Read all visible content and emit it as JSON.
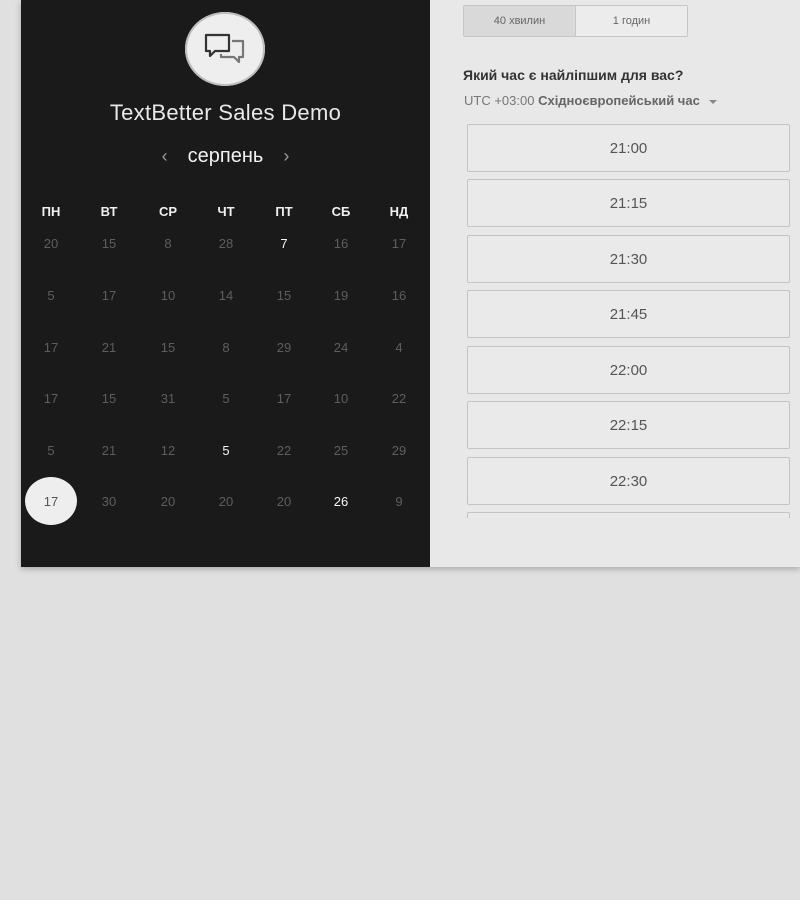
{
  "calendar": {
    "title": "TextBetter Sales Demo",
    "month": "серпень",
    "weekdays": [
      "ПН",
      "ВТ",
      "СР",
      "ЧТ",
      "ПТ",
      "СБ",
      "НД"
    ],
    "weeks": [
      [
        {
          "d": "20"
        },
        {
          "d": "15"
        },
        {
          "d": "8"
        },
        {
          "d": "28"
        },
        {
          "d": "7",
          "available": true
        },
        {
          "d": "16"
        },
        {
          "d": "17"
        }
      ],
      [
        {
          "d": "5"
        },
        {
          "d": "17"
        },
        {
          "d": "10"
        },
        {
          "d": "14"
        },
        {
          "d": "15"
        },
        {
          "d": "19"
        },
        {
          "d": "16"
        }
      ],
      [
        {
          "d": "17"
        },
        {
          "d": "21"
        },
        {
          "d": "15"
        },
        {
          "d": "8"
        },
        {
          "d": "29"
        },
        {
          "d": "24"
        },
        {
          "d": "4"
        }
      ],
      [
        {
          "d": "17"
        },
        {
          "d": "15"
        },
        {
          "d": "31"
        },
        {
          "d": "5"
        },
        {
          "d": "17"
        },
        {
          "d": "10"
        },
        {
          "d": "22"
        }
      ],
      [
        {
          "d": "5"
        },
        {
          "d": "21"
        },
        {
          "d": "12"
        },
        {
          "d": "5",
          "available": true
        },
        {
          "d": "22"
        },
        {
          "d": "25"
        },
        {
          "d": "29"
        }
      ],
      [
        {
          "d": "17",
          "selected": true
        },
        {
          "d": "30"
        },
        {
          "d": "20"
        },
        {
          "d": "20"
        },
        {
          "d": "20"
        },
        {
          "d": "26",
          "available": true
        },
        {
          "d": "9"
        }
      ]
    ],
    "icons": {
      "logo": "chat-bubbles-icon",
      "prev": "chevron-left-icon",
      "next": "chevron-right-icon"
    },
    "prev_arrow": "‹",
    "next_arrow": "›"
  },
  "scheduler": {
    "durations": [
      {
        "label": "40 хвилин",
        "active": true
      },
      {
        "label": "1 годин",
        "active": false
      }
    ],
    "question": "Який час є найліпшим для вас?",
    "timezone_offset": "UTC +03:00",
    "timezone_name": "Східноєвропейський час",
    "slots": [
      "21:00",
      "21:15",
      "21:30",
      "21:45",
      "22:00",
      "22:15",
      "22:30"
    ]
  },
  "colors": {
    "panel_dark": "#1a1a1a",
    "panel_light": "#e8e8e8",
    "page_background": "#e0e0e0"
  }
}
